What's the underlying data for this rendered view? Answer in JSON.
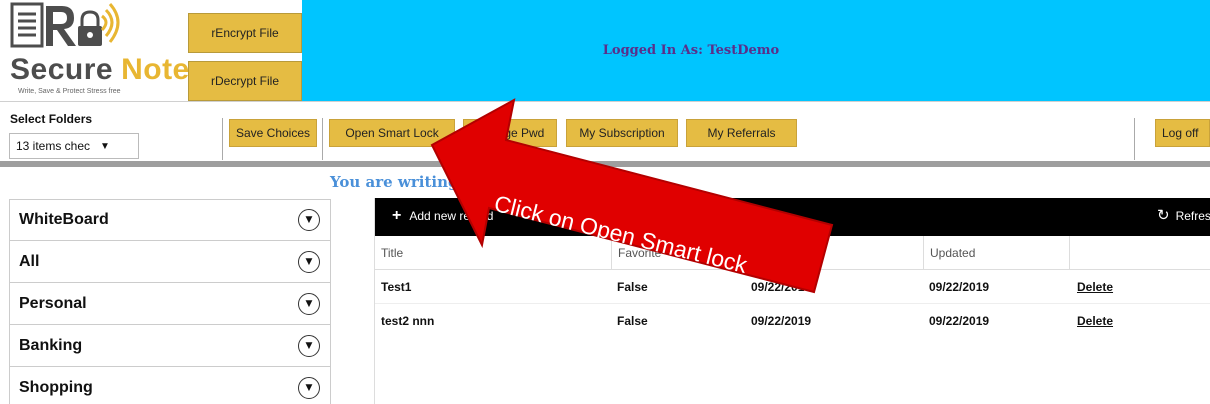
{
  "header": {
    "logo_word_1": "Secure",
    "logo_word_2": "Note",
    "logo_tagline": "Write, Save & Protect Stress free",
    "encrypt_label": "rEncrypt File",
    "decrypt_label": "rDecrypt File",
    "logged_in_text": "Logged In As: TestDemo"
  },
  "toolbar": {
    "folders_label": "Select Folders",
    "folder_select_value": "13 items chec",
    "buttons": [
      {
        "label": "Save Choices"
      },
      {
        "label": "Open Smart Lock"
      },
      {
        "label": "Change Pwd"
      },
      {
        "label": "My Subscription"
      },
      {
        "label": "My Referrals"
      }
    ],
    "logoff_label": "Log off"
  },
  "content": {
    "writing_text": "You are writing"
  },
  "sidebar": {
    "items": [
      {
        "label": "WhiteBoard"
      },
      {
        "label": "All"
      },
      {
        "label": "Personal"
      },
      {
        "label": "Banking"
      },
      {
        "label": "Shopping"
      }
    ]
  },
  "grid": {
    "add_label": "Add new record",
    "refresh_label": "Refresh",
    "headers": [
      "Title",
      "Favorite",
      "Created",
      "Updated",
      ""
    ],
    "rows": [
      {
        "title": "Test1",
        "favorite": "False",
        "created": "09/22/2019",
        "updated": "09/22/2019",
        "action": "Delete"
      },
      {
        "title": "test2 nnn",
        "favorite": "False",
        "created": "09/22/2019",
        "updated": "09/22/2019",
        "action": "Delete"
      }
    ]
  },
  "annotation": {
    "text": "Click on Open Smart lock",
    "color": "#e00000"
  },
  "colors": {
    "banner": "#00c5ff",
    "button": "#e5bc43",
    "accent_text": "#4a90d9"
  }
}
